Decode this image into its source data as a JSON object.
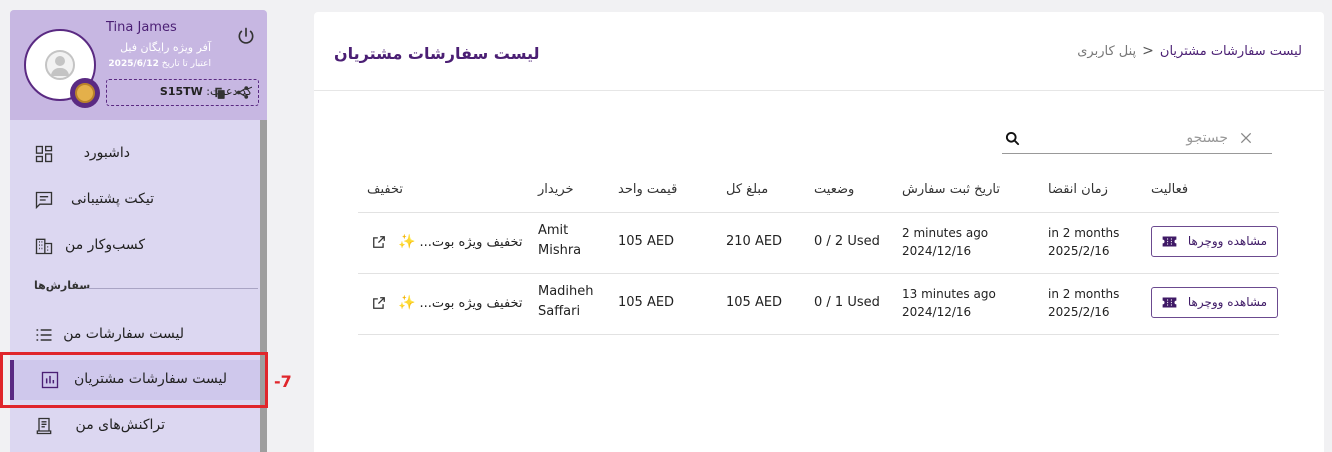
{
  "profile": {
    "name": "Tina James",
    "plan": "آفر ویژه رایگان فیل",
    "validity_label": "اعتبار تا تاریخ",
    "validity_date": "2025/6/12",
    "invite_label": "کد دعوت:",
    "invite_code": "S15TW"
  },
  "sidebar": {
    "items": [
      {
        "label": "داشبورد",
        "icon": "dashboard-icon"
      },
      {
        "label": "تیکت پشتیبانی",
        "icon": "message-icon"
      },
      {
        "label": "کسب‌وکار من",
        "icon": "building-icon"
      },
      {
        "label": "لیست سفارشات من",
        "icon": "list-icon"
      },
      {
        "label": "لیست سفارشات مشتریان",
        "icon": "chart-icon"
      },
      {
        "label": "تراکنش‌های من",
        "icon": "receipt-icon"
      }
    ],
    "section_orders": "سفارش‌ها",
    "annotation": "-7"
  },
  "main": {
    "title": "لیست سفارشات مشتریان",
    "breadcrumb": {
      "current": "لیست سفارشات مشتریان",
      "separator": "<",
      "home": "پنل کاربری"
    },
    "search": {
      "placeholder": "جستجو",
      "value": ""
    }
  },
  "table": {
    "headers": {
      "discount": "تخفیف",
      "buyer": "خریدار",
      "unit_price": "قیمت واحد",
      "total": "مبلغ کل",
      "status": "وضعیت",
      "order_date": "تاریخ ثبت سفارش",
      "expiry": "زمان انقضا",
      "action": "فعالیت"
    },
    "rows": [
      {
        "discount": "...تخفیف ویژه بوت",
        "buyer": "Amit Mishra",
        "unit_price": "105 AED",
        "total": "210 AED",
        "status": "0 / 2 Used",
        "order_rel": "2 minutes ago",
        "order_date": "2024/12/16",
        "expiry_rel": "in 2 months",
        "expiry_date": "2025/2/16",
        "action": "مشاهده ووچرها"
      },
      {
        "discount": "...تخفیف ویژه بوت",
        "buyer": "Madiheh Saffari",
        "unit_price": "105 AED",
        "total": "105 AED",
        "status": "0 / 1 Used",
        "order_rel": "13 minutes ago",
        "order_date": "2024/12/16",
        "expiry_rel": "in 2 months",
        "expiry_date": "2025/2/16",
        "action": "مشاهده ووچرها"
      }
    ]
  },
  "colors": {
    "accent": "#4b1f74",
    "sidebar_bg": "#dcd7f1",
    "profile_bg": "#c7b7e2",
    "highlight": "#e0262b"
  }
}
